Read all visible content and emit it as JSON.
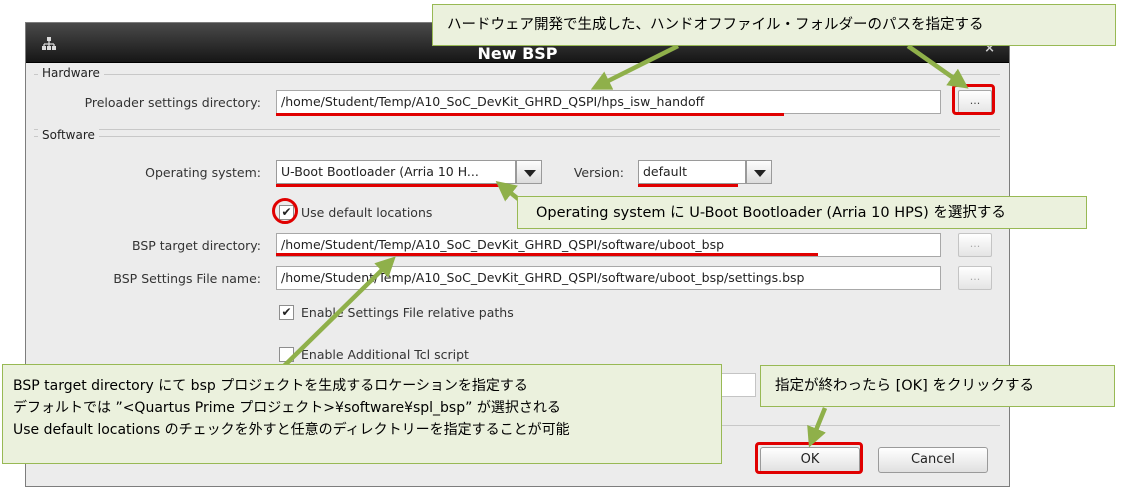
{
  "dialog": {
    "title": "New BSP",
    "close_glyph": "×"
  },
  "hardware": {
    "group_title": "Hardware",
    "preloader_label": "Preloader settings directory:",
    "preloader_value": "/home/Student/Temp/A10_SoC_DevKit_GHRD_QSPI/hps_isw_handoff",
    "browse_label": "..."
  },
  "software": {
    "group_title": "Software",
    "os_label": "Operating system:",
    "os_value": "U-Boot Bootloader (Arria 10 H...",
    "version_label": "Version:",
    "version_value": "default",
    "use_default_label": "Use default locations",
    "use_default_checked": true,
    "bsp_target_label": "BSP target directory:",
    "bsp_target_value": "/home/Student/Temp/A10_SoC_DevKit_GHRD_QSPI/software/uboot_bsp",
    "bsp_settings_label": "BSP Settings File name:",
    "bsp_settings_value": "/home/Student/Temp/A10_SoC_DevKit_GHRD_QSPI/software/uboot_bsp/settings.bsp",
    "relative_paths_label": "Enable Settings File relative paths",
    "relative_paths_checked": true,
    "tcl_label": "Enable Additional Tcl script",
    "tcl_checked": false,
    "browse_label": "...",
    "check_glyph": "✔"
  },
  "buttons": {
    "ok_label": "OK",
    "cancel_label": "Cancel"
  },
  "callouts": {
    "handoff": "ハードウェア開発で生成した、ハンドオフファイル・フォルダーのパスを指定する",
    "os_select": "Operating system に U-Boot Bootloader (Arria 10 HPS) を選択する",
    "bsp_line1": "BSP target directory にて bsp プロジェクトを生成するロケーションを指定する",
    "bsp_line2": "デフォルトでは ”<Quartus Prime プロジェクト>¥software¥spl_bsp” が選択される",
    "bsp_line3": "Use default locations のチェックを外すと任意のディレクトリーを指定することが可能",
    "ok_hint": "指定が終わったら [OK] をクリックする"
  },
  "colors": {
    "highlight": "#e00000",
    "callout_fill": "#ebf1dd",
    "callout_border": "#98b954",
    "arrow": "#8fb04a"
  }
}
